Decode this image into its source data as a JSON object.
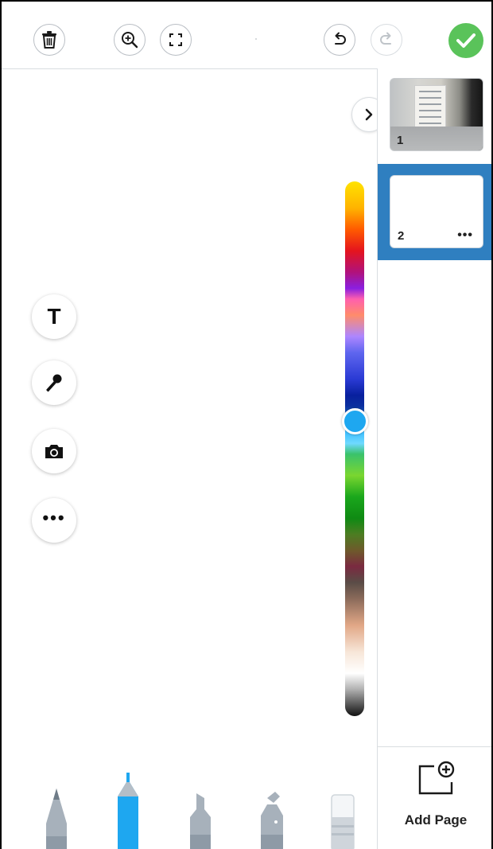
{
  "colors": {
    "accent": "#2f7fc0",
    "selected_pen": "#1ea7f0",
    "done": "#5ac35a"
  },
  "toolbar": {
    "delete_icon": "trash-icon",
    "zoom_icon": "zoom-in-icon",
    "fit_icon": "fullscreen-icon",
    "undo_icon": "undo-icon",
    "redo_icon": "redo-icon",
    "done_icon": "check-icon"
  },
  "pages": [
    {
      "number": "1",
      "thumbnail": "photo"
    },
    {
      "number": "2",
      "thumbnail": "blank",
      "selected": true,
      "more": "•••"
    }
  ],
  "sidebar": {
    "add_page_label": "Add Page",
    "add_page_icon": "add-page-icon",
    "collapse_icon": "chevron-right-icon"
  },
  "left_tools": [
    {
      "id": "text",
      "glyph": "T",
      "icon": "text-icon"
    },
    {
      "id": "mic",
      "icon": "microphone-icon"
    },
    {
      "id": "camera",
      "icon": "camera-icon"
    },
    {
      "id": "more",
      "glyph": "•••",
      "icon": "more-icon"
    }
  ],
  "pens": [
    {
      "id": "pencil",
      "selected": false
    },
    {
      "id": "marker",
      "selected": true
    },
    {
      "id": "highlighter",
      "selected": false
    },
    {
      "id": "special",
      "selected": false
    },
    {
      "id": "eraser",
      "selected": false
    }
  ],
  "color_slider": {
    "value": 0.45,
    "current_color": "#1ea7f0"
  }
}
